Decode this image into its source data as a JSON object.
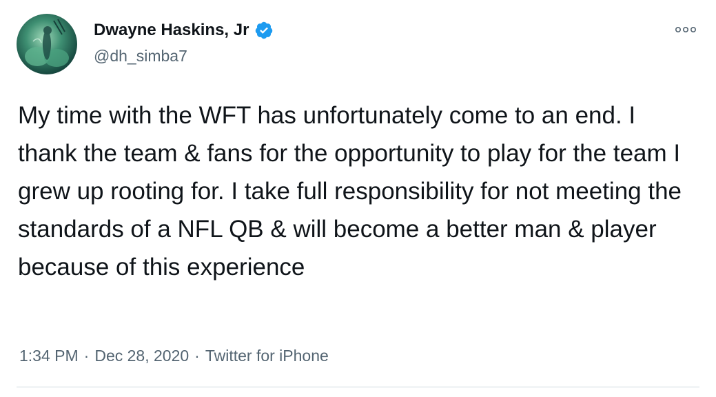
{
  "tweet": {
    "author": {
      "display_name": "Dwayne Haskins, Jr",
      "handle": "@dh_simba7",
      "verified": true,
      "avatar_icon": "profile-avatar"
    },
    "more_icon": "more-options-icon",
    "text": "My time with the WFT has unfortunately come to an end. I thank the team & fans for the opportunity to play for the team I grew up rooting for. I take full responsibility for not meeting the standards of a NFL QB & will become a better man & player because of this experience",
    "time": "1:34 PM",
    "separator": "·",
    "date": "Dec 28, 2020",
    "source": "Twitter for iPhone"
  },
  "colors": {
    "text_primary": "#0f1419",
    "text_secondary": "#536471",
    "verified_blue": "#1d9bf0",
    "divider": "#cfd9de"
  }
}
